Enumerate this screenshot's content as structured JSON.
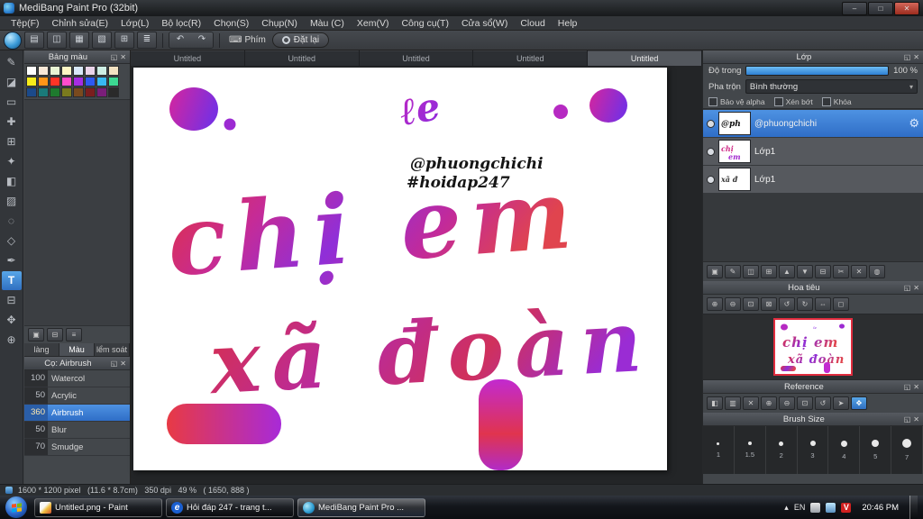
{
  "titlebar": {
    "title": "MediBang Paint Pro (32bit)"
  },
  "menu": {
    "items": [
      "Tệp(F)",
      "Chỉnh sửa(E)",
      "Lớp(L)",
      "Bộ lọc(R)",
      "Chọn(S)",
      "Chụp(N)",
      "Màu (C)",
      "Xem(V)",
      "Công cụ(T)",
      "Cửa sổ(W)",
      "Cloud",
      "Help"
    ]
  },
  "toolbar": {
    "phim": "Phím",
    "dat_lai": "Đặt lại"
  },
  "tabs": {
    "items": [
      "Untitled",
      "Untitled",
      "Untitled",
      "Untitled",
      "Untitled"
    ]
  },
  "palette": {
    "title": "Bảng màu",
    "tabs": [
      "làng",
      "Màu",
      "lểm soát"
    ],
    "colors": [
      "#ffffff",
      "#f8e8d8",
      "#e8f4d4",
      "#fdf6c4",
      "#d8e8f8",
      "#ead4ea",
      "#cdeee4",
      "#f2e2c2",
      "#f8ec1a",
      "#ff9518",
      "#ff3426",
      "#ff4ccc",
      "#a62ce2",
      "#2e59f2",
      "#37b9f2",
      "#3cd892",
      "#1b4a8a",
      "#1a7a7a",
      "#1e7a2e",
      "#7a7a1e",
      "#7a4a1e",
      "#7a1e1e",
      "#7a1e7a",
      "#2a2a2a"
    ]
  },
  "brushes": {
    "title": "Cọ: Airbrush",
    "items": [
      {
        "size": "100",
        "name": "Watercol"
      },
      {
        "size": "50",
        "name": "Acrylic"
      },
      {
        "size": "360",
        "name": "Airbrush"
      },
      {
        "size": "50",
        "name": "Blur"
      },
      {
        "size": "70",
        "name": "Smudge"
      }
    ]
  },
  "artwork": {
    "swirl": "ℓe",
    "handle": "@phuongchichi",
    "hashtag": "#hoidap247",
    "line1": "chị em",
    "line2": "xã đoàn",
    "colors": {
      "red": "#e3313d",
      "purple": "#8f2fd8",
      "magenta": "#c927c0"
    }
  },
  "layers_panel": {
    "title": "Lớp",
    "opacity_label": "Độ trong",
    "opacity_value": "100 %",
    "blend_label": "Pha trộn",
    "blend_value": "Bình thường",
    "protect_alpha": "Bảo vệ alpha",
    "clip": "Xén bớt",
    "lock": "Khóa",
    "layers": [
      {
        "name": "@phuongchichi"
      },
      {
        "name": "Lớp1"
      },
      {
        "name": "Lớp1"
      }
    ]
  },
  "navigator": {
    "title": "Hoa tiêu"
  },
  "reference": {
    "title": "Reference"
  },
  "brush_size": {
    "title": "Brush Size",
    "sizes": [
      "1",
      "1.5",
      "2",
      "3",
      "4",
      "5",
      "7"
    ]
  },
  "statusbar": {
    "text": "1600 * 1200 pixel   (11.6 * 8.7cm)   350 dpi   49 %   ( 1650, 888 )"
  },
  "taskbar": {
    "windows": [
      "Untitled.png - Paint",
      "Hỏi đáp 247 - trang t...",
      "MediBang Paint Pro ..."
    ],
    "lang": "EN",
    "time": "20:46 PM"
  }
}
